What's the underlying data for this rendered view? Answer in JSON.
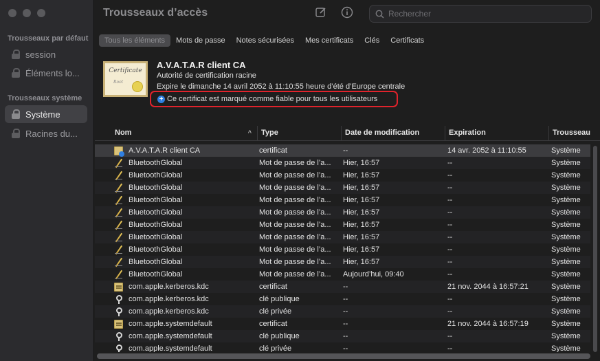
{
  "window": {
    "title": "Trousseaux d’accès"
  },
  "sidebar": {
    "section_default": "Trousseaux par défaut",
    "default_items": [
      {
        "label": "session"
      },
      {
        "label": "Éléments lo..."
      }
    ],
    "section_system": "Trousseaux système",
    "system_items": [
      {
        "label": "Système",
        "selected": true
      },
      {
        "label": "Racines du..."
      }
    ]
  },
  "toolbar": {
    "compose_icon": "square-pencil-icon",
    "info_icon": "info-circle-icon",
    "search_placeholder": "Rechercher"
  },
  "tabs": [
    {
      "label": "Tous les éléments",
      "active": true
    },
    {
      "label": "Mots de passe"
    },
    {
      "label": "Notes sécurisées"
    },
    {
      "label": "Mes certificats"
    },
    {
      "label": "Clés"
    },
    {
      "label": "Certificats"
    }
  ],
  "certificate": {
    "image_text": "Certificate",
    "image_subtext": "Root",
    "name": "A.V.A.T.A.R client CA",
    "kind": "Autorité de certification racine",
    "expires": "Expire le dimanche 14 avril 2052 à 11:10:55 heure d’été d’Europe centrale",
    "trust": "Ce certificat est marqué comme fiable pour tous les utilisateurs"
  },
  "table": {
    "columns": {
      "name": "Nom",
      "type": "Type",
      "date": "Date de modification",
      "expiration": "Expiration",
      "keychain": "Trousseau"
    },
    "sort_indicator": "^",
    "rows": [
      {
        "icon": "certblue",
        "name": "A.V.A.T.A.R client CA",
        "type": "certificat",
        "date": "--",
        "expiration": "14 avr. 2052 à 11:10:55",
        "keychain": "Système"
      },
      {
        "icon": "pen",
        "name": "BluetoothGlobal",
        "type": "Mot de passe de l’a...",
        "date": "Hier, 16:57",
        "expiration": "--",
        "keychain": "Système"
      },
      {
        "icon": "pen",
        "name": "BluetoothGlobal",
        "type": "Mot de passe de l’a...",
        "date": "Hier, 16:57",
        "expiration": "--",
        "keychain": "Système"
      },
      {
        "icon": "pen",
        "name": "BluetoothGlobal",
        "type": "Mot de passe de l’a...",
        "date": "Hier, 16:57",
        "expiration": "--",
        "keychain": "Système"
      },
      {
        "icon": "pen",
        "name": "BluetoothGlobal",
        "type": "Mot de passe de l’a...",
        "date": "Hier, 16:57",
        "expiration": "--",
        "keychain": "Système"
      },
      {
        "icon": "pen",
        "name": "BluetoothGlobal",
        "type": "Mot de passe de l’a...",
        "date": "Hier, 16:57",
        "expiration": "--",
        "keychain": "Système"
      },
      {
        "icon": "pen",
        "name": "BluetoothGlobal",
        "type": "Mot de passe de l’a...",
        "date": "Hier, 16:57",
        "expiration": "--",
        "keychain": "Système"
      },
      {
        "icon": "pen",
        "name": "BluetoothGlobal",
        "type": "Mot de passe de l’a...",
        "date": "Hier, 16:57",
        "expiration": "--",
        "keychain": "Système"
      },
      {
        "icon": "pen",
        "name": "BluetoothGlobal",
        "type": "Mot de passe de l’a...",
        "date": "Hier, 16:57",
        "expiration": "--",
        "keychain": "Système"
      },
      {
        "icon": "pen",
        "name": "BluetoothGlobal",
        "type": "Mot de passe de l’a...",
        "date": "Hier, 16:57",
        "expiration": "--",
        "keychain": "Système"
      },
      {
        "icon": "pen",
        "name": "BluetoothGlobal",
        "type": "Mot de passe de l’a...",
        "date": "Aujourd’hui, 09:40",
        "expiration": "--",
        "keychain": "Système"
      },
      {
        "icon": "cert",
        "name": "com.apple.kerberos.kdc",
        "type": "certificat",
        "date": "--",
        "expiration": "21 nov. 2044 à 16:57:21",
        "keychain": "Système"
      },
      {
        "icon": "key",
        "name": "com.apple.kerberos.kdc",
        "type": "clé publique",
        "date": "--",
        "expiration": "--",
        "keychain": "Système"
      },
      {
        "icon": "key",
        "name": "com.apple.kerberos.kdc",
        "type": "clé privée",
        "date": "--",
        "expiration": "--",
        "keychain": "Système"
      },
      {
        "icon": "cert",
        "name": "com.apple.systemdefault",
        "type": "certificat",
        "date": "--",
        "expiration": "21 nov. 2044 à 16:57:19",
        "keychain": "Système"
      },
      {
        "icon": "key",
        "name": "com.apple.systemdefault",
        "type": "clé publique",
        "date": "--",
        "expiration": "--",
        "keychain": "Système"
      },
      {
        "icon": "key",
        "name": "com.apple.systemdefault",
        "type": "clé privée",
        "date": "--",
        "expiration": "--",
        "keychain": "Système"
      }
    ]
  }
}
